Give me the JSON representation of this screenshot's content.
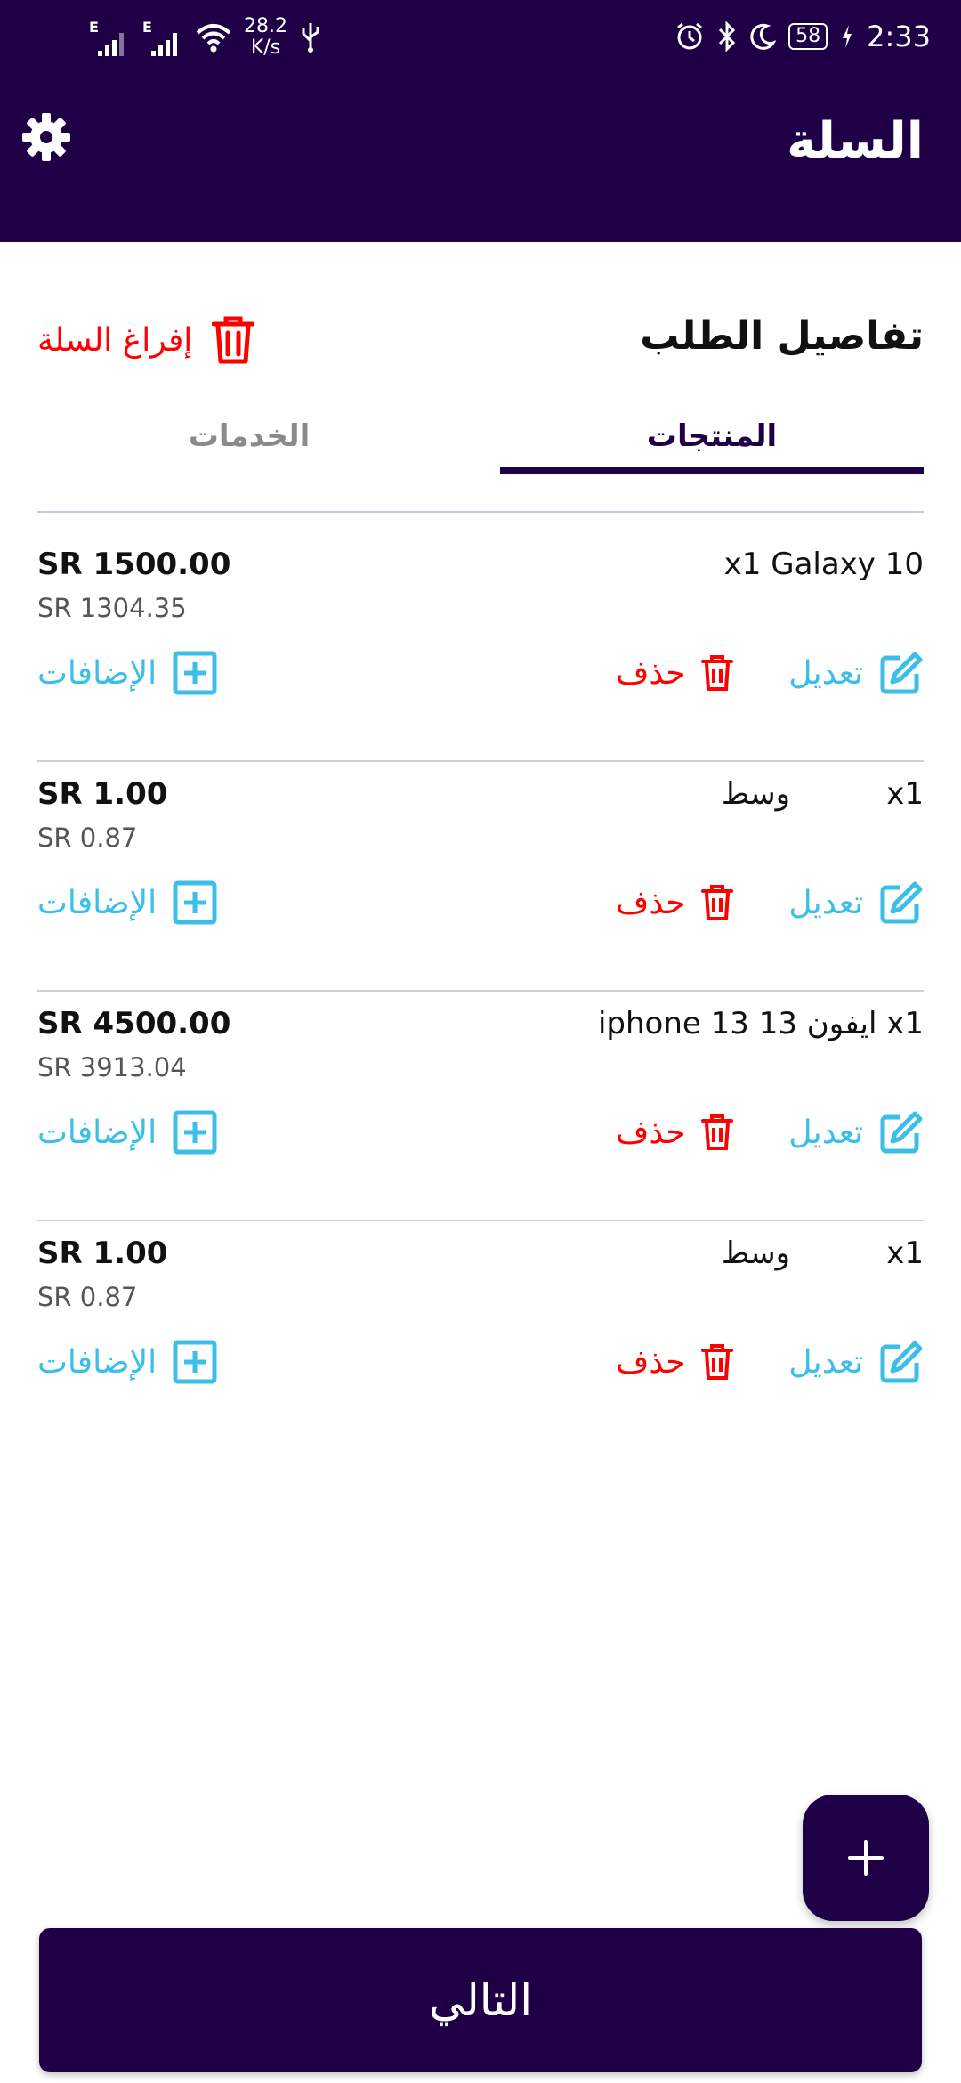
{
  "status_bar": {
    "net_label_1": "E",
    "net_label_2": "E",
    "speed_value": "28.2",
    "speed_unit": "K/s",
    "battery": "58",
    "time": "2:33"
  },
  "header": {
    "title": "السلة",
    "settings_icon": "gear-icon"
  },
  "order": {
    "section_title": "تفاصيل الطلب",
    "empty_cart_label": "إفراغ السلة"
  },
  "tabs": [
    {
      "label": "المنتجات",
      "active": true
    },
    {
      "label": "الخدمات",
      "active": false
    }
  ],
  "items": [
    {
      "name": "x1 Galaxy 10",
      "price": "SR 1500.00",
      "price_sub": "SR 1304.35"
    },
    {
      "qty": "x1",
      "variant": "وسط",
      "price": "SR 1.00",
      "price_sub": "SR 0.87"
    },
    {
      "name": "iphone 13 13 ايفون x1",
      "price": "SR 4500.00",
      "price_sub": "SR 3913.04"
    },
    {
      "qty": "x1",
      "variant": "وسط",
      "price": "SR 1.00",
      "price_sub": "SR 0.87"
    }
  ],
  "actions": {
    "edit_label": "تعديل",
    "delete_label": "حذف",
    "addons_label": "الإضافات"
  },
  "footer": {
    "next_label": "التالي",
    "fab_icon": "plus-icon"
  },
  "colors": {
    "primary": "#1f0047",
    "danger": "#ff0000",
    "accent": "#3bbfe8"
  }
}
